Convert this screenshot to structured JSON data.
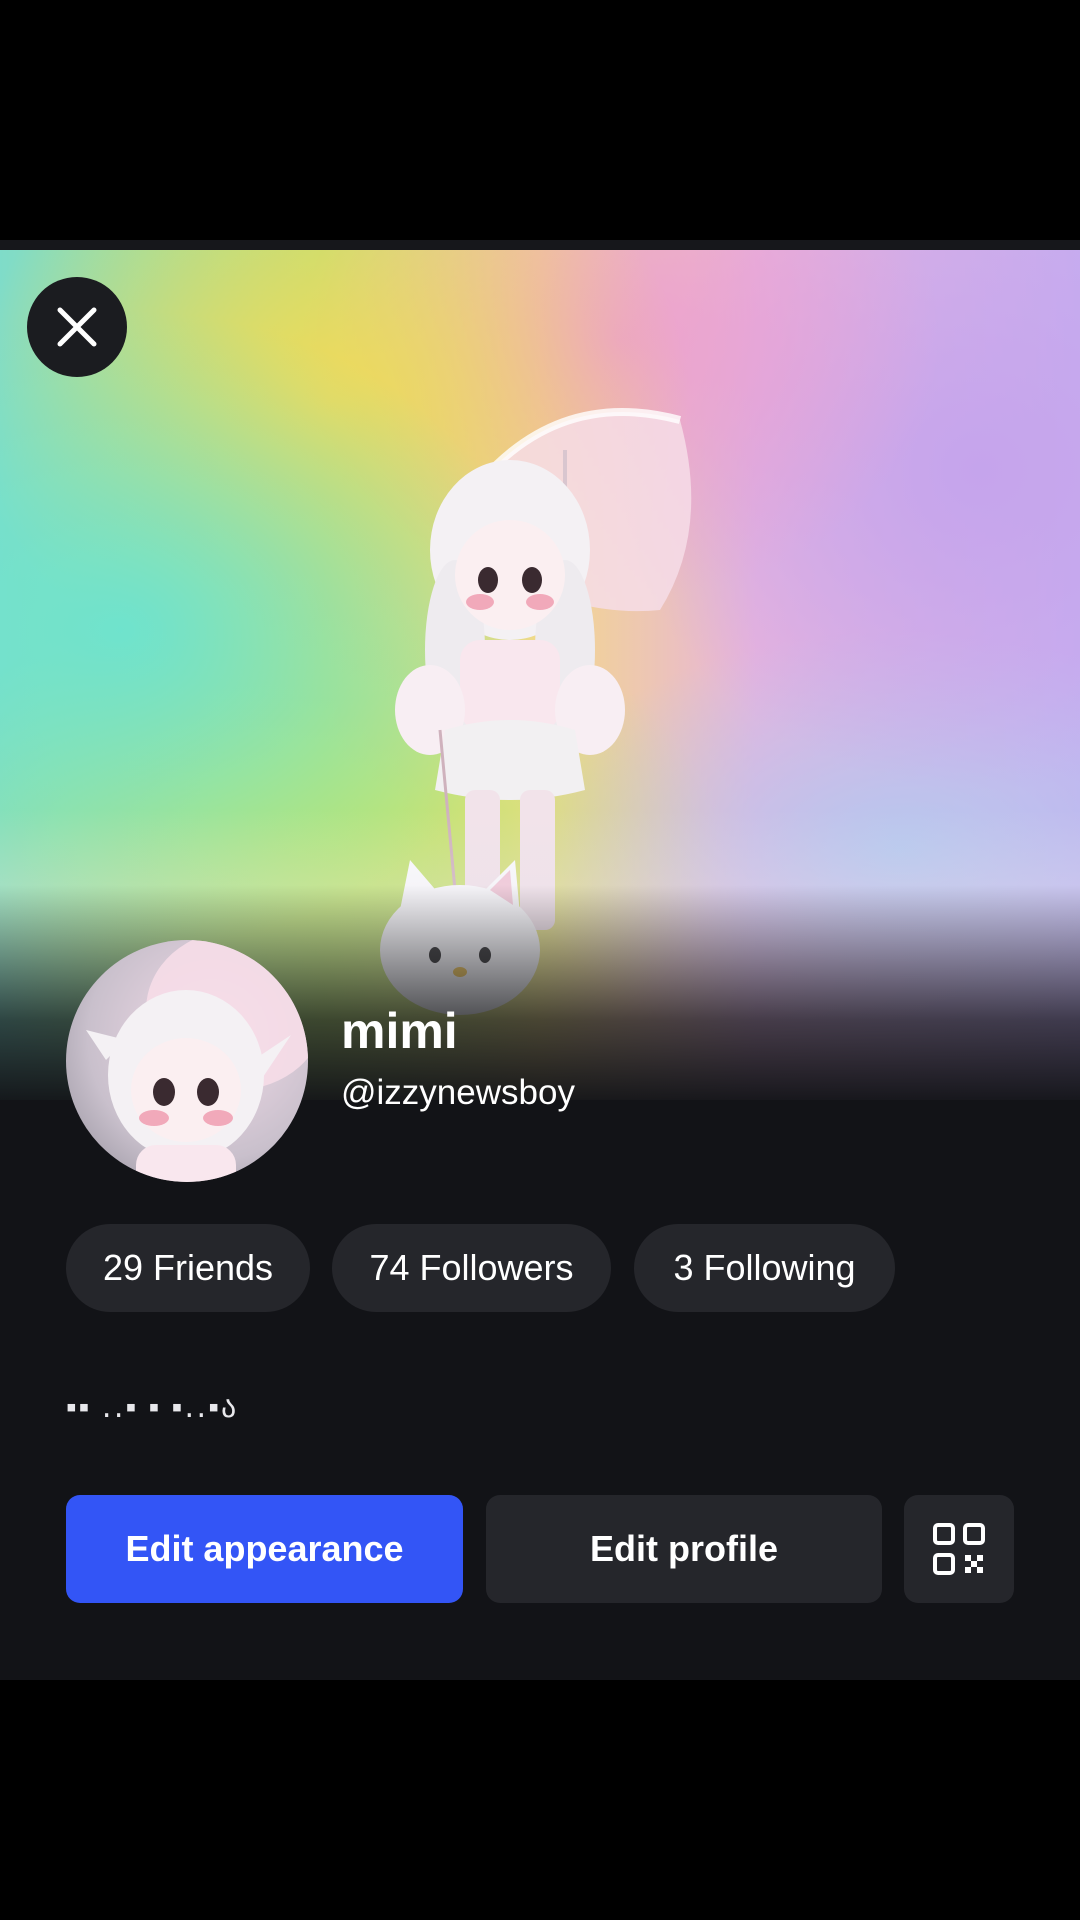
{
  "profile": {
    "display_name": "mimi",
    "username": "@izzynewsboy",
    "bio": "▪▪ ․․▪ ▪ ▪․․▪ა"
  },
  "stats": [
    {
      "label": "29 Friends"
    },
    {
      "label": "74 Followers"
    },
    {
      "label": "3 Following"
    }
  ],
  "actions": {
    "edit_appearance": "Edit appearance",
    "edit_profile": "Edit profile"
  },
  "icons": {
    "close": "close-icon",
    "qr": "qr-code-icon"
  },
  "colors": {
    "primary": "#3355f6",
    "surface": "#121317",
    "pill": "#25262b"
  }
}
